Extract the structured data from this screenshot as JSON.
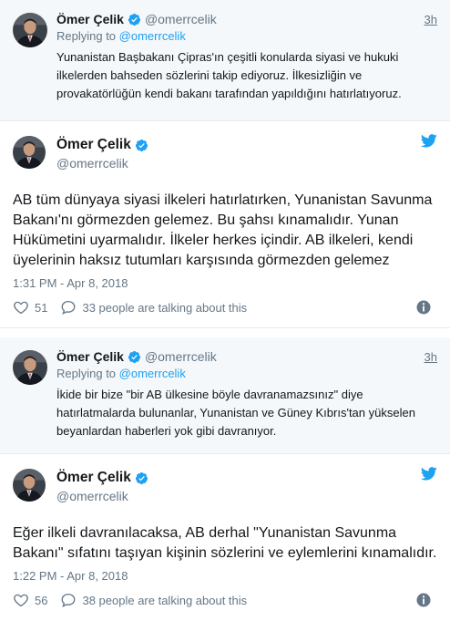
{
  "colors": {
    "accent": "#1da1f2",
    "muted": "#657786",
    "text": "#14171a",
    "reply_bg": "#f5f8fa"
  },
  "tweets": [
    {
      "type": "reply",
      "name": "Ömer Çelik",
      "handle": "@omerrcelik",
      "time": "3h",
      "replying_prefix": "Replying to",
      "replying_to": "@omerrcelik",
      "text": "Yunanistan Başbakanı Çipras'ın çeşitli konularda siyasi ve hukuki ilkelerden bahseden sözlerini takip ediyoruz. İlkesizliğin ve provakatörlüğün kendi bakanı tarafından yapıldığını hatırlatıyoruz."
    },
    {
      "type": "main",
      "name": "Ömer Çelik",
      "handle": "@omerrcelik",
      "text": "AB tüm dünyaya siyasi ilkeleri hatırlatırken, Yunanistan Savunma Bakanı'nı görmezden gelemez. Bu şahsı kınamalıdır. Yunan Hükümetini uyarmalıdır. İlkeler herkes içindir. AB ilkeleri, kendi üyelerinin haksız tutumları karşısında görmezden gelemez",
      "datetime": "1:31 PM - Apr 8, 2018",
      "likes": "51",
      "talking": "33 people are talking about this"
    },
    {
      "type": "reply",
      "name": "Ömer Çelik",
      "handle": "@omerrcelik",
      "time": "3h",
      "replying_prefix": "Replying to",
      "replying_to": "@omerrcelik",
      "text": "İkide bir bize \"bir AB ülkesine böyle davranamazsınız\" diye hatırlatmalarda bulunanlar, Yunanistan ve Güney Kıbrıs'tan yükselen beyanlardan haberleri yok gibi davranıyor."
    },
    {
      "type": "main",
      "name": "Ömer Çelik",
      "handle": "@omerrcelik",
      "text": "Eğer ilkeli davranılacaksa, AB derhal \"Yunanistan Savunma Bakanı\" sıfatını taşıyan kişinin sözlerini ve eylemlerini kınamalıdır.",
      "datetime": "1:22 PM - Apr 8, 2018",
      "likes": "56",
      "talking": "38 people are talking about this"
    }
  ]
}
